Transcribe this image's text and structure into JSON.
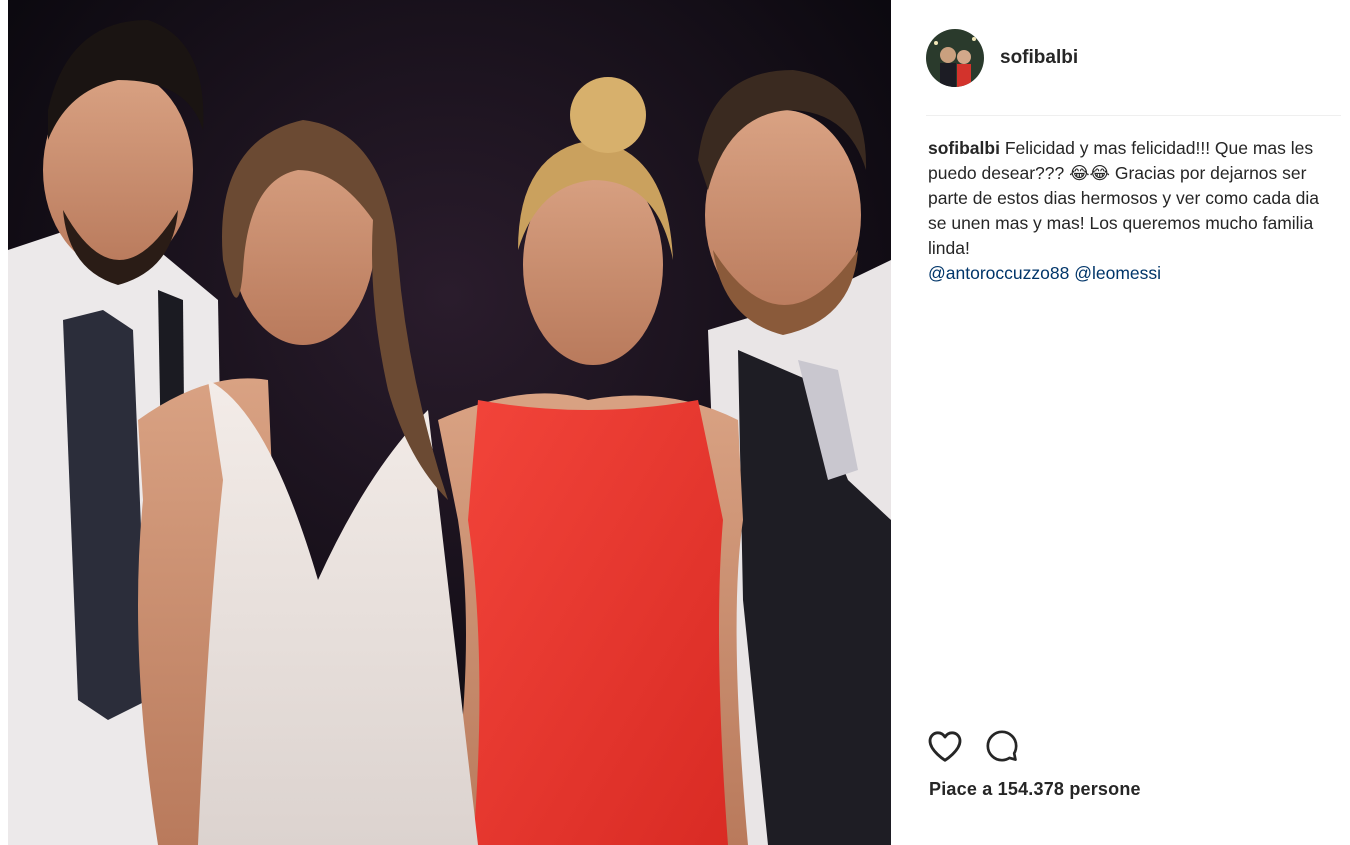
{
  "post": {
    "username": "sofibalbi",
    "caption": {
      "username": "sofibalbi",
      "text": "Felicidad y mas felicidad!!! Que mas les puedo desear??? 😂😂 Gracias por dejarnos ser parte de estos dias hermosos y ver como cada dia se unen mas y mas! Los queremos mucho familia linda!",
      "mentions": [
        "@antoroccuzzo88",
        "@leomessi"
      ]
    },
    "actions": {
      "like_icon": "heart-icon",
      "comment_icon": "comment-icon"
    },
    "likes_text": "Piace a 154.378 persone"
  },
  "colors": {
    "mention": "#003569",
    "text": "#262626",
    "divider": "#efefef"
  }
}
